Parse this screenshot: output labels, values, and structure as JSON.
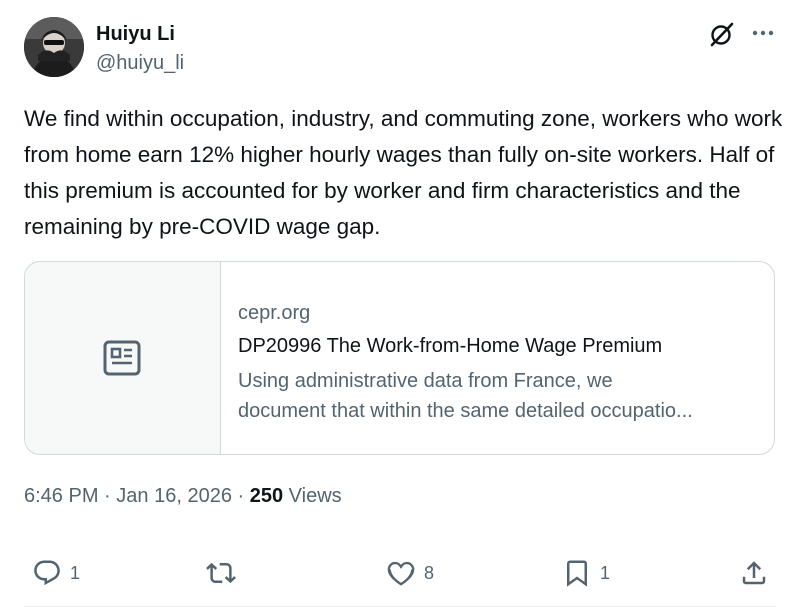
{
  "author": {
    "name": "Huiyu Li",
    "handle": "@huiyu_li"
  },
  "tweet": {
    "text": "We find within occupation, industry, and commuting zone, workers who work from home earn 12% higher hourly wages than fully on-site workers. Half of this premium is accounted for by worker and firm characteristics and the remaining by pre-COVID wage gap."
  },
  "link_card": {
    "domain": "cepr.org",
    "title": "DP20996 The Work-from-Home Wage Premium",
    "description_line1": "Using administrative data from France, we",
    "description_line2": "document that within the same detailed occupatio...",
    "thumbnail_icon": "article-icon"
  },
  "meta": {
    "time": "6:46 PM",
    "date": "Jan 16, 2026",
    "views_count": "250",
    "views_label": "Views",
    "separator": "·"
  },
  "actions": {
    "replies": "1",
    "reposts": "",
    "likes": "8",
    "bookmarks": "1"
  },
  "colors": {
    "text_primary": "#0f1419",
    "text_secondary": "#536471",
    "border": "#cfd9de",
    "card_thumb_bg": "#f7f9f9"
  }
}
